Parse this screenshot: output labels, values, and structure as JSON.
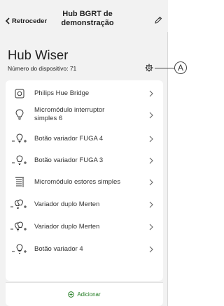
{
  "header": {
    "back_label": "Retroceder",
    "title": "Hub BGRT de demonstração",
    "edit_icon": "pencil-icon"
  },
  "device": {
    "title": "Hub Wiser",
    "number": "Número do dispositivo: 71",
    "settings_icon": "gear-icon"
  },
  "callout": {
    "label": "A"
  },
  "items": [
    {
      "label": "Philips Hue Bridge",
      "icon": "hue-bridge-icon"
    },
    {
      "label": "Micromódulo interruptor simples 6",
      "icon": "bulb-icon"
    },
    {
      "label": "Botão variador FUGA 4",
      "icon": "dimmer-icon"
    },
    {
      "label": "Botão variador FUGA 3",
      "icon": "dimmer-icon"
    },
    {
      "label": "Micromódulo estores simples",
      "icon": "shutter-icon"
    },
    {
      "label": "Variador duplo Merten",
      "icon": "double-dimmer-icon"
    },
    {
      "label": "Variador duplo Merten",
      "icon": "double-dimmer-icon"
    },
    {
      "label": "Botão variador 4",
      "icon": "dimmer-icon"
    }
  ],
  "add_button": {
    "label": "Adicionar",
    "icon": "plus-circle-icon"
  },
  "colors": {
    "accent": "#1f7a1f",
    "background": "#f2f2f2",
    "card": "#ffffff"
  }
}
